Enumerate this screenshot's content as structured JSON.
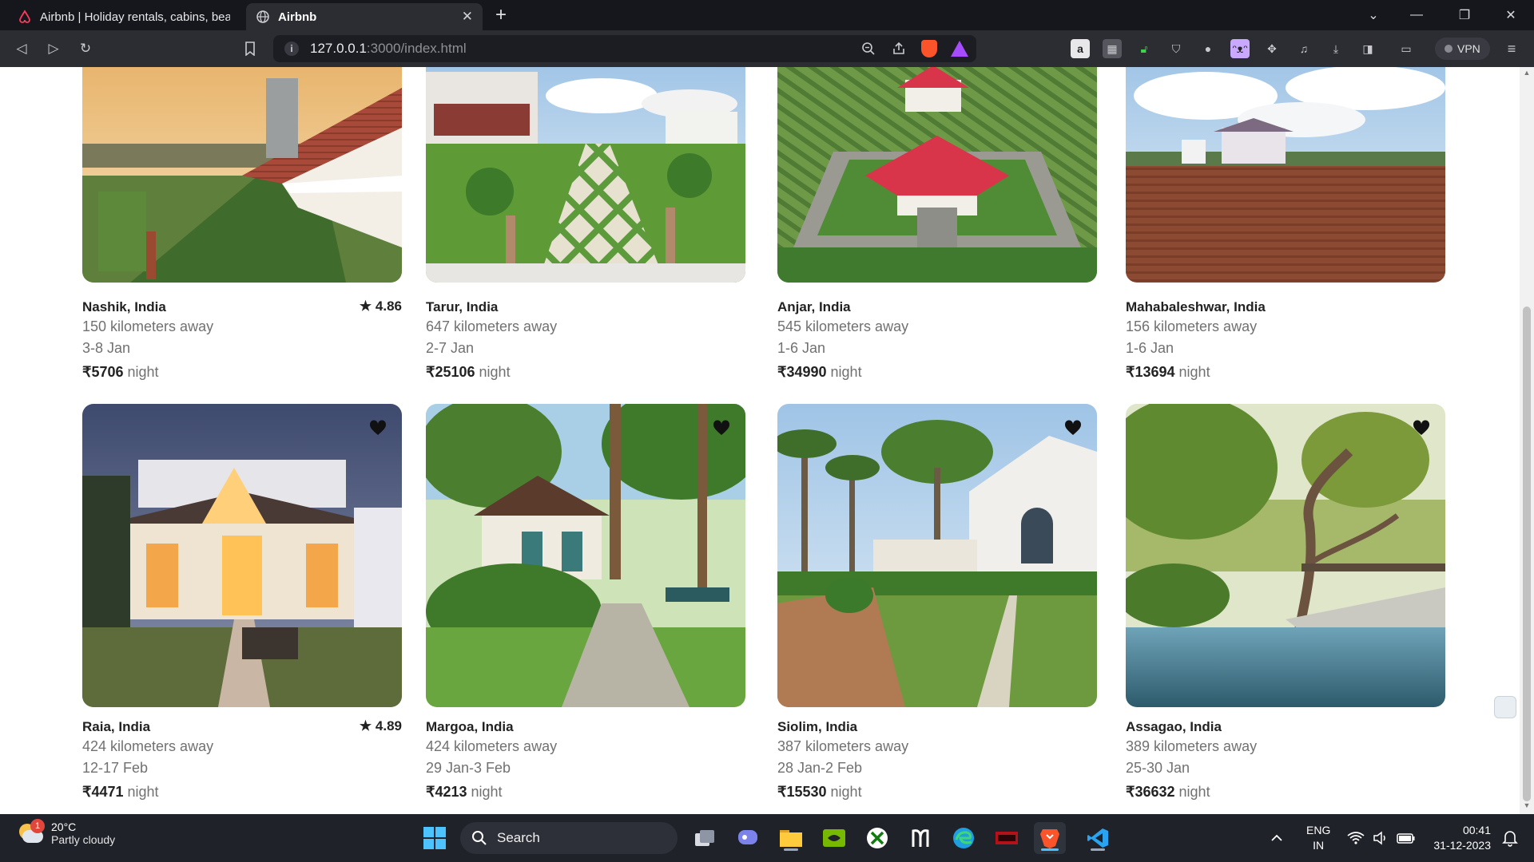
{
  "browser": {
    "tabs": [
      {
        "title": "Airbnb | Holiday rentals, cabins, beach",
        "active": false
      },
      {
        "title": "Airbnb",
        "active": true
      }
    ],
    "url_host": "127.0.0.1",
    "url_path": ":3000/index.html",
    "vpn_label": "VPN",
    "accent": "#fb542b"
  },
  "listings": [
    {
      "location": "Nashik, India",
      "distance": "150 kilometers away",
      "dates": "3-8 Jan",
      "price": "₹5706",
      "unit": "night",
      "rating": "4.86"
    },
    {
      "location": "Tarur, India",
      "distance": "647 kilometers away",
      "dates": "2-7 Jan",
      "price": "₹25106",
      "unit": "night"
    },
    {
      "location": "Anjar, India",
      "distance": "545 kilometers away",
      "dates": "1-6 Jan",
      "price": "₹34990",
      "unit": "night"
    },
    {
      "location": "Mahabaleshwar, India",
      "distance": "156 kilometers away",
      "dates": "1-6 Jan",
      "price": "₹13694",
      "unit": "night"
    },
    {
      "location": "Raia, India",
      "distance": "424 kilometers away",
      "dates": "12-17 Feb",
      "price": "₹4471",
      "unit": "night",
      "rating": "4.89"
    },
    {
      "location": "Margoa, India",
      "distance": "424 kilometers away",
      "dates": "29 Jan-3 Feb",
      "price": "₹4213",
      "unit": "night"
    },
    {
      "location": "Siolim, India",
      "distance": "387 kilometers away",
      "dates": "28 Jan-2 Feb",
      "price": "₹15530",
      "unit": "night"
    },
    {
      "location": "Assagao, India",
      "distance": "389 kilometers away",
      "dates": "25-30 Jan",
      "price": "₹36632",
      "unit": "night"
    }
  ],
  "taskbar": {
    "weather_temp": "20°C",
    "weather_desc": "Partly cloudy",
    "weather_badge": "1",
    "search_label": "Search",
    "lang_1": "ENG",
    "lang_2": "IN",
    "time": "00:41",
    "date": "31-12-2023"
  }
}
